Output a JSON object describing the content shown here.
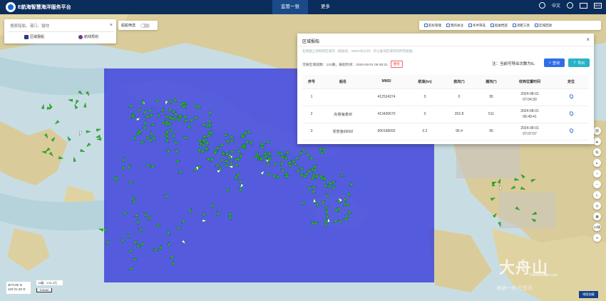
{
  "topbar": {
    "title": "E航海智慧海洋服务平台",
    "tabs": [
      {
        "label": "监管一张图",
        "active": true
      },
      {
        "label": "更多",
        "active": false
      }
    ],
    "lang": "中文",
    "box_icon_label": "BDS"
  },
  "search": {
    "placeholder": "搜索船舶、港口、锚地",
    "tools": [
      {
        "label": "区域报船"
      },
      {
        "label": "航线规划"
      }
    ],
    "filter_label": "船舶筛选"
  },
  "map_toolbar": {
    "items": [
      "航标管理",
      "我的关注",
      "条件筛选",
      "船舶档案",
      "测距工具",
      "区域回放"
    ]
  },
  "dialog": {
    "title": "区域报船",
    "hint": "在地图上绘制的区域内（船舶名、MMSI号以外）可以查询区域内的所有船舶。",
    "info": "可报区域船数：131艘，报船时间：2024-08-01 09:48:21",
    "reset_label": "重绘",
    "note": "注：当前可导出次数为0。",
    "query_label": "查询",
    "export_label": "导出",
    "columns": [
      "序号",
      "船名",
      "MMSI",
      "航速(kn)",
      "航向(°)",
      "艏向(°)",
      "收到位置时间",
      "定位"
    ],
    "rows": [
      {
        "no": "1",
        "name": "",
        "mmsi": "412524374",
        "speed": "0",
        "course": "0",
        "heading": "95",
        "date": "2024-08-01",
        "time": "07:04:30"
      },
      {
        "no": "2",
        "name": "舟港海通38",
        "mmsi": "413430670",
        "speed": "0",
        "course": "202.8",
        "heading": "511",
        "date": "2024-08-01",
        "time": "06:49:41"
      },
      {
        "no": "3",
        "name": "浙普渔68092",
        "mmsi": "900168092",
        "speed": "0.2",
        "course": "95.4",
        "heading": "95",
        "date": "2024-08-01",
        "time": "07:07:07"
      }
    ]
  },
  "side_tools": [
    "测",
    "▲",
    "标",
    "▸",
    "+",
    "−",
    "L",
    "◎",
    "▦",
    "12级",
    "⌖"
  ],
  "status": {
    "coord_lat": "30°0.05' N",
    "coord_lon": "122°21.33' E",
    "scale_text": "13级 · 1:51.4万",
    "scale_bar": "0.5nmi",
    "zoom_label": "地图加载"
  },
  "watermark": {
    "main": "大舟山",
    "sub": "Dozhoushan.com",
    "sub2": "海纳一舟 行东方"
  },
  "colors": {
    "topbar": "#0b2d5c",
    "selection": "#3a3fdc",
    "ship": "#22c322",
    "accent": "#2f6ee8"
  }
}
